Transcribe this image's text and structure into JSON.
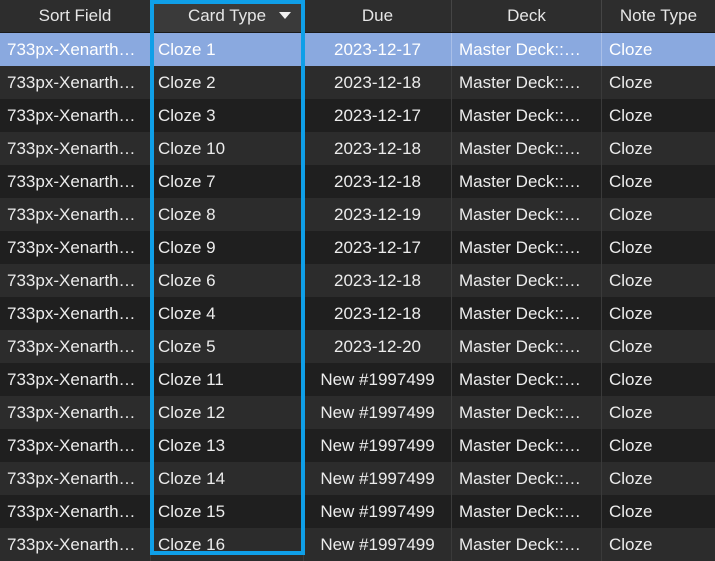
{
  "columns": [
    {
      "label": "Sort Field"
    },
    {
      "label": "Card Type",
      "sorted": true,
      "sort_direction": "descending"
    },
    {
      "label": "Due"
    },
    {
      "label": "Deck"
    },
    {
      "label": "Note Type"
    }
  ],
  "rows": [
    {
      "sort_field": "733px-Xenarth…",
      "card_type": "Cloze 1",
      "due": "2023-12-17",
      "deck": "Master Deck::…",
      "note_type": "Cloze",
      "selected": true
    },
    {
      "sort_field": "733px-Xenarth…",
      "card_type": "Cloze 2",
      "due": "2023-12-18",
      "deck": "Master Deck::…",
      "note_type": "Cloze"
    },
    {
      "sort_field": "733px-Xenarth…",
      "card_type": "Cloze 3",
      "due": "2023-12-17",
      "deck": "Master Deck::…",
      "note_type": "Cloze"
    },
    {
      "sort_field": "733px-Xenarth…",
      "card_type": "Cloze 10",
      "due": "2023-12-18",
      "deck": "Master Deck::…",
      "note_type": "Cloze"
    },
    {
      "sort_field": "733px-Xenarth…",
      "card_type": "Cloze 7",
      "due": "2023-12-18",
      "deck": "Master Deck::…",
      "note_type": "Cloze"
    },
    {
      "sort_field": "733px-Xenarth…",
      "card_type": "Cloze 8",
      "due": "2023-12-19",
      "deck": "Master Deck::…",
      "note_type": "Cloze"
    },
    {
      "sort_field": "733px-Xenarth…",
      "card_type": "Cloze 9",
      "due": "2023-12-17",
      "deck": "Master Deck::…",
      "note_type": "Cloze"
    },
    {
      "sort_field": "733px-Xenarth…",
      "card_type": "Cloze 6",
      "due": "2023-12-18",
      "deck": "Master Deck::…",
      "note_type": "Cloze"
    },
    {
      "sort_field": "733px-Xenarth…",
      "card_type": "Cloze 4",
      "due": "2023-12-18",
      "deck": "Master Deck::…",
      "note_type": "Cloze"
    },
    {
      "sort_field": "733px-Xenarth…",
      "card_type": "Cloze 5",
      "due": "2023-12-20",
      "deck": "Master Deck::…",
      "note_type": "Cloze"
    },
    {
      "sort_field": "733px-Xenarth…",
      "card_type": "Cloze 11",
      "due": "New #1997499",
      "deck": "Master Deck::…",
      "note_type": "Cloze"
    },
    {
      "sort_field": "733px-Xenarth…",
      "card_type": "Cloze 12",
      "due": "New #1997499",
      "deck": "Master Deck::…",
      "note_type": "Cloze"
    },
    {
      "sort_field": "733px-Xenarth…",
      "card_type": "Cloze 13",
      "due": "New #1997499",
      "deck": "Master Deck::…",
      "note_type": "Cloze"
    },
    {
      "sort_field": "733px-Xenarth…",
      "card_type": "Cloze 14",
      "due": "New #1997499",
      "deck": "Master Deck::…",
      "note_type": "Cloze"
    },
    {
      "sort_field": "733px-Xenarth…",
      "card_type": "Cloze 15",
      "due": "New #1997499",
      "deck": "Master Deck::…",
      "note_type": "Cloze"
    },
    {
      "sort_field": "733px-Xenarth…",
      "card_type": "Cloze 16",
      "due": "New #1997499",
      "deck": "Master Deck::…",
      "note_type": "Cloze"
    }
  ],
  "colors": {
    "highlight_border": "#0f9fe8",
    "selected_row": "#8aa9df",
    "row_odd": "#2c2c2c",
    "row_even": "#1f1f1f",
    "header_bg": "#2d2d2d"
  },
  "icons": {
    "sort_indicator": "sort-descending-icon"
  }
}
